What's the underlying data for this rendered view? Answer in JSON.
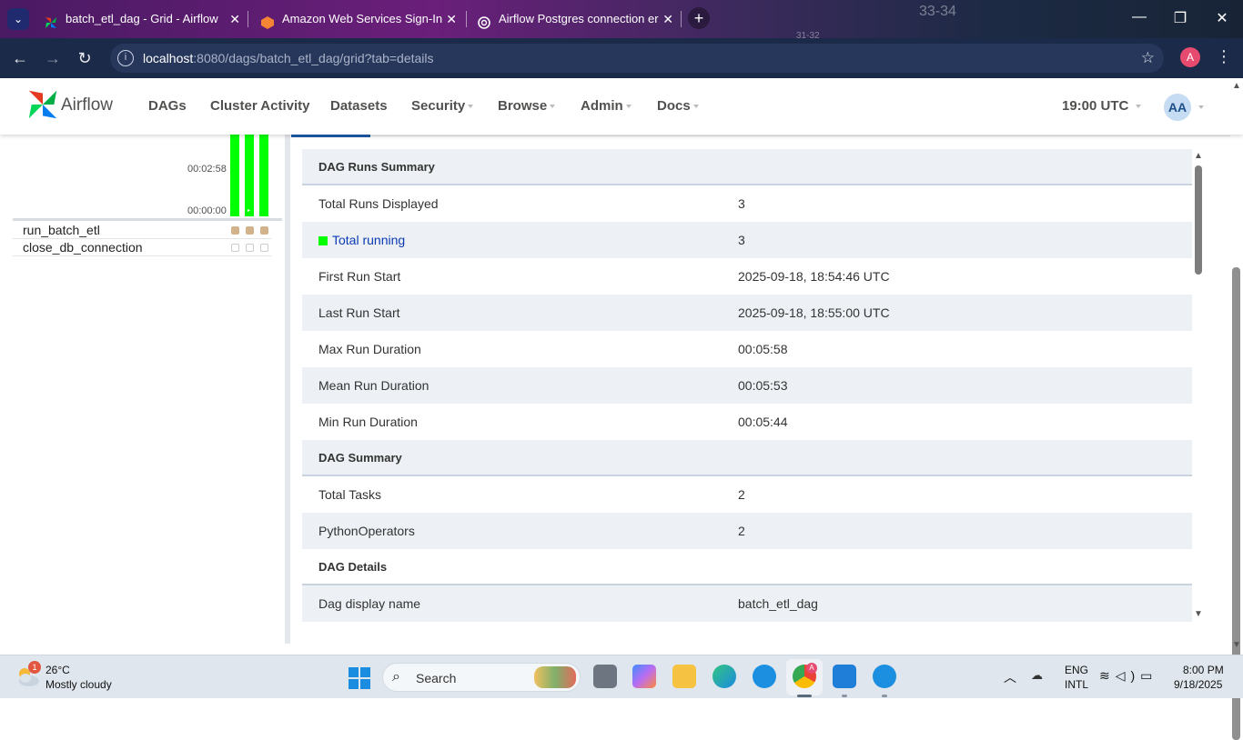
{
  "browser": {
    "tabs": [
      {
        "title": "batch_etl_dag - Grid - Airflow",
        "close": "✕"
      },
      {
        "title": "Amazon Web Services Sign-In",
        "close": "✕"
      },
      {
        "title": "Airflow Postgres connection er",
        "close": "✕"
      }
    ],
    "new_tab": "+",
    "window_controls": {
      "minimize": "—",
      "maximize": "❐",
      "close": "✕"
    },
    "url_host": "localhost",
    "url_rest": ":8080/dags/batch_etl_dag/grid?tab=details",
    "profile_initial": "A",
    "background_text": [
      "33-34",
      "31-32"
    ]
  },
  "airflow_nav": {
    "brand": "Airflow",
    "items": [
      {
        "label": "DAGs",
        "dropdown": false
      },
      {
        "label": "Cluster Activity",
        "dropdown": false
      },
      {
        "label": "Datasets",
        "dropdown": false
      },
      {
        "label": "Security",
        "dropdown": true
      },
      {
        "label": "Browse",
        "dropdown": true
      },
      {
        "label": "Admin",
        "dropdown": true
      },
      {
        "label": "Docs",
        "dropdown": true
      }
    ],
    "clock": "19:00 UTC",
    "avatar": "AA"
  },
  "grid": {
    "duration_ticks": [
      "00:02:58",
      "00:00:00"
    ],
    "run_count": 3,
    "tasks": [
      {
        "name": "run_batch_etl",
        "state": "filled"
      },
      {
        "name": "close_db_connection",
        "state": "empty"
      }
    ],
    "colors": {
      "running": "#00ff00",
      "task_filled": "#d2b48c"
    }
  },
  "details": {
    "rows": [
      {
        "type": "head",
        "key": "DAG Runs Summary",
        "value": ""
      },
      {
        "type": "plain",
        "key": "Total Runs Displayed",
        "value": "3"
      },
      {
        "type": "running",
        "key": "Total running",
        "value": "3"
      },
      {
        "type": "plain",
        "key": "First Run Start",
        "value": "2025-09-18, 18:54:46 UTC"
      },
      {
        "type": "plain",
        "key": "Last Run Start",
        "value": "2025-09-18, 18:55:00 UTC"
      },
      {
        "type": "plain",
        "key": "Max Run Duration",
        "value": "00:05:58"
      },
      {
        "type": "plain",
        "key": "Mean Run Duration",
        "value": "00:05:53"
      },
      {
        "type": "plain",
        "key": "Min Run Duration",
        "value": "00:05:44"
      },
      {
        "type": "head",
        "key": "DAG Summary",
        "value": ""
      },
      {
        "type": "plain",
        "key": "Total Tasks",
        "value": "2"
      },
      {
        "type": "plain",
        "key": "PythonOperators",
        "value": "2"
      },
      {
        "type": "head",
        "key": "DAG Details",
        "value": ""
      },
      {
        "type": "plain",
        "key": "Dag display name",
        "value": "batch_etl_dag"
      }
    ]
  },
  "taskbar": {
    "weather_temp": "26°C",
    "weather_desc": "Mostly cloudy",
    "weather_badge": "1",
    "search_label": "Search",
    "lang_1": "ENG",
    "lang_2": "INTL",
    "time": "8:00 PM",
    "date": "9/18/2025",
    "apps": [
      "widgets",
      "task-view",
      "copilot",
      "file-explorer",
      "edge",
      "docker",
      "chrome",
      "vscode",
      "docker-desktop"
    ]
  }
}
